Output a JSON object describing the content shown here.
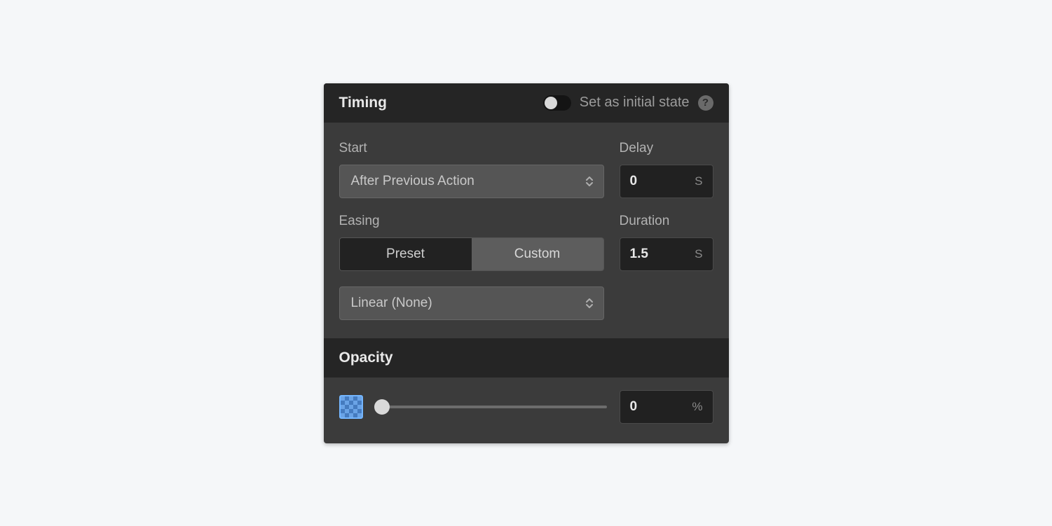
{
  "timing": {
    "title": "Timing",
    "initial_state_label": "Set as initial state",
    "initial_state_on": false,
    "start": {
      "label": "Start",
      "value": "After Previous Action"
    },
    "delay": {
      "label": "Delay",
      "value": "0",
      "unit": "S"
    },
    "easing": {
      "label": "Easing",
      "preset_label": "Preset",
      "custom_label": "Custom",
      "active": "custom",
      "curve": "Linear (None)"
    },
    "duration": {
      "label": "Duration",
      "value": "1.5",
      "unit": "S"
    }
  },
  "opacity": {
    "title": "Opacity",
    "value": "0",
    "unit": "%",
    "slider_percent": 0
  }
}
